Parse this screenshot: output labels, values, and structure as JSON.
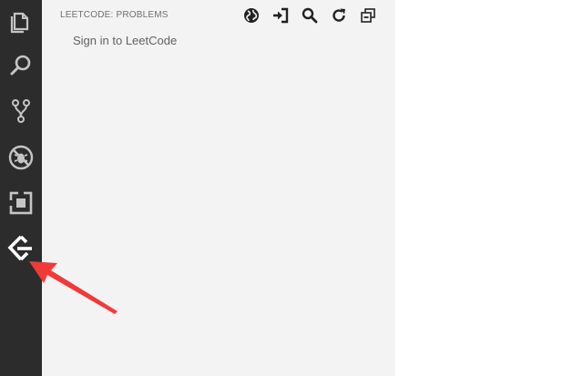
{
  "activity_bar": {
    "items": [
      {
        "name": "explorer",
        "icon": "files-icon"
      },
      {
        "name": "search",
        "icon": "search-icon"
      },
      {
        "name": "source-control",
        "icon": "source-control-icon"
      },
      {
        "name": "debug",
        "icon": "debug-icon"
      },
      {
        "name": "extensions",
        "icon": "extensions-icon"
      },
      {
        "name": "leetcode",
        "icon": "leetcode-icon"
      }
    ]
  },
  "side_bar": {
    "title": "LEETCODE: PROBLEMS",
    "actions": [
      {
        "name": "globe",
        "icon": "globe-icon"
      },
      {
        "name": "sign-in",
        "icon": "sign-in-icon"
      },
      {
        "name": "search",
        "icon": "search-icon"
      },
      {
        "name": "refresh",
        "icon": "refresh-icon"
      },
      {
        "name": "collapse-all",
        "icon": "collapse-all-icon"
      }
    ],
    "tree_item": "Sign in to LeetCode"
  },
  "colors": {
    "activity_bar_bg": "#2c2c2c",
    "side_bar_bg": "#f3f3f3",
    "annotation_arrow": "#f03a3a"
  }
}
